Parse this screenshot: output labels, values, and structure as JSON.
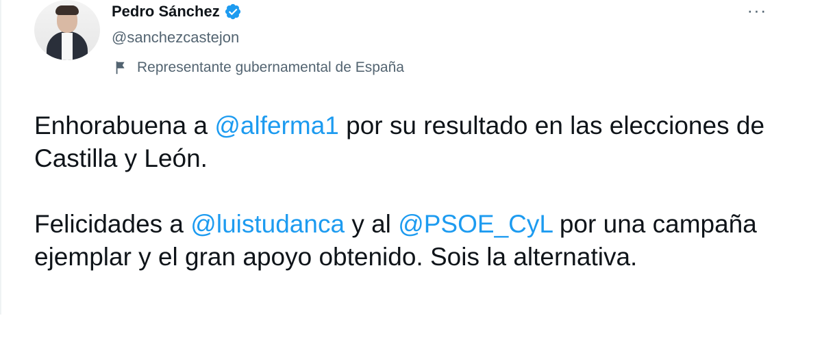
{
  "author": {
    "name": "Pedro Sánchez",
    "handle": "@sanchezcastejon",
    "label": "Representante gubernamental de España",
    "verified_icon": "verified-badge-icon",
    "label_icon": "flag-icon"
  },
  "more_icon": "···",
  "tweet": {
    "p1": {
      "t1": "Enhorabuena a ",
      "m1": "@alferma1",
      "t2": " por su resultado en las elecciones de Castilla y León."
    },
    "p2": {
      "t1": "Felicidades a ",
      "m1": "@luistudanca",
      "t2": " y al ",
      "m2": "@PSOE_CyL",
      "t3": " por una campaña ejemplar y el gran apoyo obtenido. Sois la alternativa."
    }
  },
  "colors": {
    "text": "#0f1419",
    "secondary": "#536471",
    "accent": "#1d9bf0"
  }
}
